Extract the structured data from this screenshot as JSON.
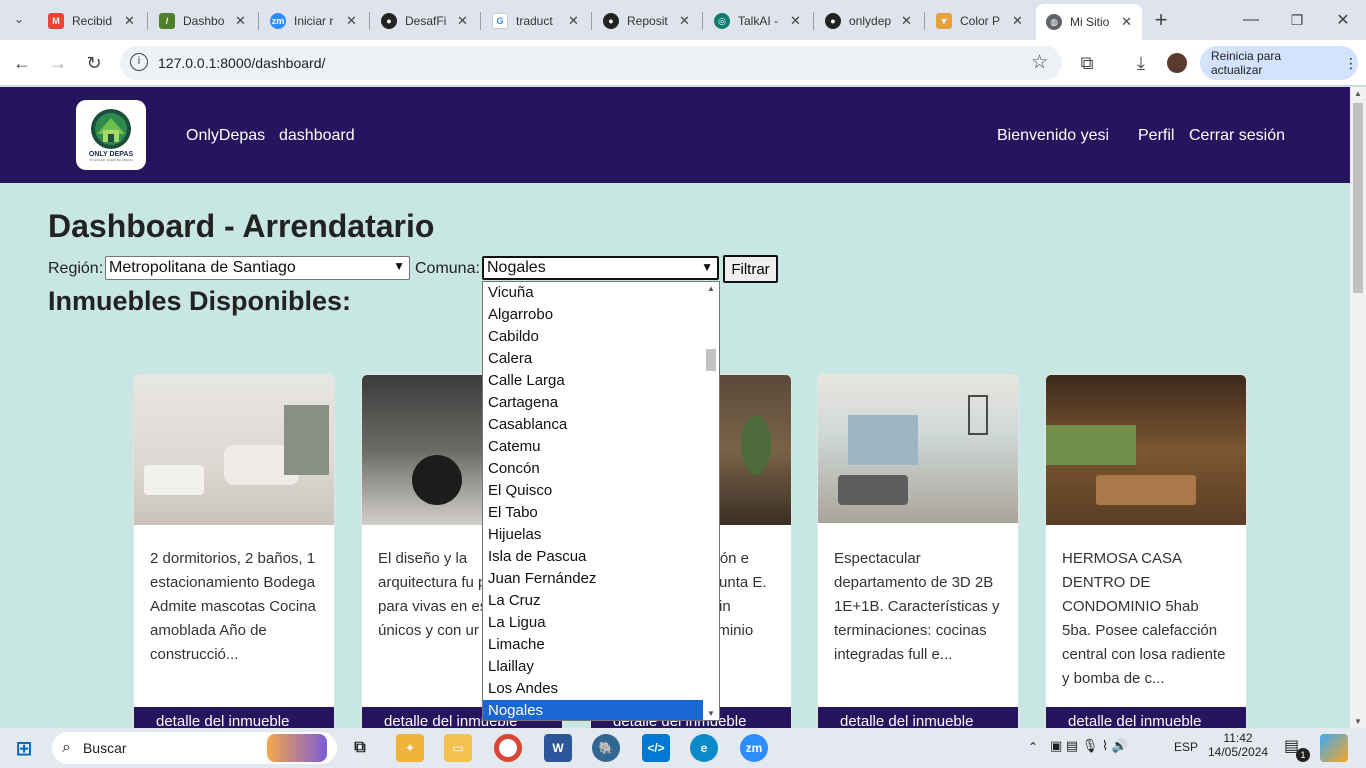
{
  "browser": {
    "tabs": [
      {
        "label": "Recibid",
        "icon": "gmail-icon"
      },
      {
        "label": "Dashbo",
        "icon": "dashboard-icon"
      },
      {
        "label": "Iniciar r",
        "icon": "zoom-icon"
      },
      {
        "label": "DesafFi",
        "icon": "github-icon"
      },
      {
        "label": "traduct",
        "icon": "google-icon"
      },
      {
        "label": "Reposit",
        "icon": "github-icon"
      },
      {
        "label": "TalkAI -",
        "icon": "talkai-icon"
      },
      {
        "label": "onlydep",
        "icon": "github-icon"
      },
      {
        "label": "Color P",
        "icon": "colorpicker-icon"
      },
      {
        "label": "Mi Sitio",
        "icon": "globe-icon",
        "active": true
      }
    ],
    "url": "127.0.0.1:8000/dashboard/",
    "update_label": "Reinicia para actualizar"
  },
  "nav": {
    "logo_text": "ONLY DEPAS",
    "logo_tagline": "TU HOGAR, NUESTRA PASIÓN",
    "brand": "OnlyDepas",
    "dashboard": "dashboard",
    "welcome": "Bienvenido yesi",
    "profile": "Perfil",
    "logout": "Cerrar sesión"
  },
  "page": {
    "title": "Dashboard - Arrendatario",
    "region_label": "Región:",
    "region_value": "Metropolitana de Santiago",
    "comuna_label": "Comuna:",
    "comuna_value": "Nogales",
    "filter_button": "Filtrar",
    "section_title": "Inmuebles Disponibles:"
  },
  "dropdown_options": [
    "Vicuña",
    "Algarrobo",
    "Cabildo",
    "Calera",
    "Calle Larga",
    "Cartagena",
    "Casablanca",
    "Catemu",
    "Concón",
    "El Quisco",
    "El Tabo",
    "Hijuelas",
    "Isla de Pascua",
    "Juan Fernández",
    "La Cruz",
    "La Ligua",
    "Limache",
    "Llaillay",
    "Los Andes",
    "Nogales"
  ],
  "cards": [
    {
      "text": "2 dormitorios, 2 baños, 1 estacionamiento Bodega Admite mascotas Cocina amoblada Año de construcció...",
      "button": "detalle del inmueble"
    },
    {
      "text": "El diseño y la arquitectura fu pensados para vivas en espaci únicos y con ur modern...",
      "button": "detalle del inmueble"
    },
    {
      "text": "ción e Punta E. Sin ominio",
      "button": "detalle del inmueble"
    },
    {
      "text": "Espectacular departamento de 3D 2B 1E+1B. Características y terminaciones: cocinas integradas full e...",
      "button": "detalle del inmueble"
    },
    {
      "text": "HERMOSA CASA DENTRO DE CONDOMINIO 5hab 5ba. Posee calefacción central con losa radiente y bomba de c...",
      "button": "detalle del inmueble"
    }
  ],
  "taskbar": {
    "search": "Buscar",
    "lang": "ESP",
    "time": "11:42",
    "date": "14/05/2024",
    "notif_count": "1"
  },
  "colors": {
    "nav_bg": "#25155e",
    "page_bg": "#c8e6e2",
    "selected": "#1967d2"
  }
}
